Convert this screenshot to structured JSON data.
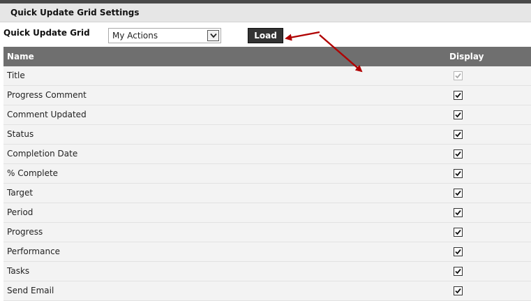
{
  "section": {
    "title": "Quick Update Grid Settings"
  },
  "grid_selector": {
    "label": "Quick Update Grid",
    "selected": "My Actions",
    "arrow_icon": "chevron-down-icon"
  },
  "load_button": {
    "label": "Load"
  },
  "table": {
    "columns": {
      "name": "Name",
      "display": "Display"
    },
    "rows": [
      {
        "name": "Title",
        "checked": true,
        "disabled": true
      },
      {
        "name": "Progress Comment",
        "checked": true,
        "disabled": false
      },
      {
        "name": "Comment Updated",
        "checked": true,
        "disabled": false
      },
      {
        "name": "Status",
        "checked": true,
        "disabled": false
      },
      {
        "name": "Completion Date",
        "checked": true,
        "disabled": false
      },
      {
        "name": "% Complete",
        "checked": true,
        "disabled": false
      },
      {
        "name": "Target",
        "checked": true,
        "disabled": false
      },
      {
        "name": "Period",
        "checked": true,
        "disabled": false
      },
      {
        "name": "Progress",
        "checked": true,
        "disabled": false
      },
      {
        "name": "Performance",
        "checked": true,
        "disabled": false
      },
      {
        "name": "Tasks",
        "checked": true,
        "disabled": false
      },
      {
        "name": "Send Email",
        "checked": true,
        "disabled": false
      }
    ]
  },
  "colors": {
    "header_bg": "#6f6f6f",
    "section_bg": "#e6e6e6",
    "button_bg": "#333333",
    "annotation_arrow": "#b00000"
  }
}
